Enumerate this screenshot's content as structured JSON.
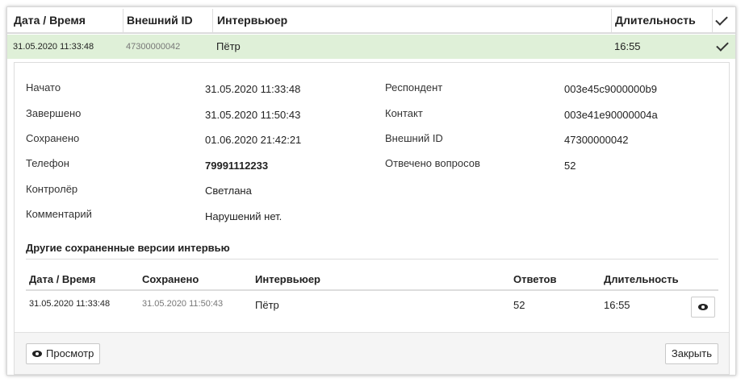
{
  "table": {
    "headers": {
      "datetime": "Дата / Время",
      "external_id": "Внешний ID",
      "interviewer": "Интервьюер",
      "duration": "Длительность"
    },
    "selected_row": {
      "datetime": "31.05.2020 11:33:48",
      "external_id": "47300000042",
      "interviewer": "Пётр",
      "duration": "16:55"
    }
  },
  "details": {
    "left": [
      {
        "label": "Начато",
        "value": "31.05.2020 11:33:48"
      },
      {
        "label": "Завершено",
        "value": "31.05.2020 11:50:43"
      },
      {
        "label": "Сохранено",
        "value": "01.06.2020 21:42:21"
      },
      {
        "label": "Телефон",
        "value": "79991112233"
      },
      {
        "label": "Контролёр",
        "value": "Светлана"
      },
      {
        "label": "Комментарий",
        "value": "Нарушений нет."
      }
    ],
    "right": [
      {
        "label": "Респондент",
        "value": "003e45c9000000b9"
      },
      {
        "label": "Контакт",
        "value": "003e41e90000004a"
      },
      {
        "label": "Внешний ID",
        "value": "47300000042"
      },
      {
        "label": "Отвечено вопросов",
        "value": "52"
      }
    ]
  },
  "versions": {
    "title": "Другие сохраненные версии интервью",
    "headers": {
      "datetime": "Дата / Время",
      "saved": "Сохранено",
      "interviewer": "Интервьюер",
      "answers": "Ответов",
      "duration": "Длительность"
    },
    "rows": [
      {
        "datetime": "31.05.2020 11:33:48",
        "saved": "31.05.2020 11:50:43",
        "interviewer": "Пётр",
        "answers": "52",
        "duration": "16:55"
      }
    ]
  },
  "footer": {
    "view_label": "Просмотр",
    "close_label": "Закрыть"
  },
  "colors": {
    "selected_row_bg": "#dff0d8",
    "muted_text": "#777777"
  },
  "icons": [
    "check-icon",
    "eye-icon"
  ]
}
